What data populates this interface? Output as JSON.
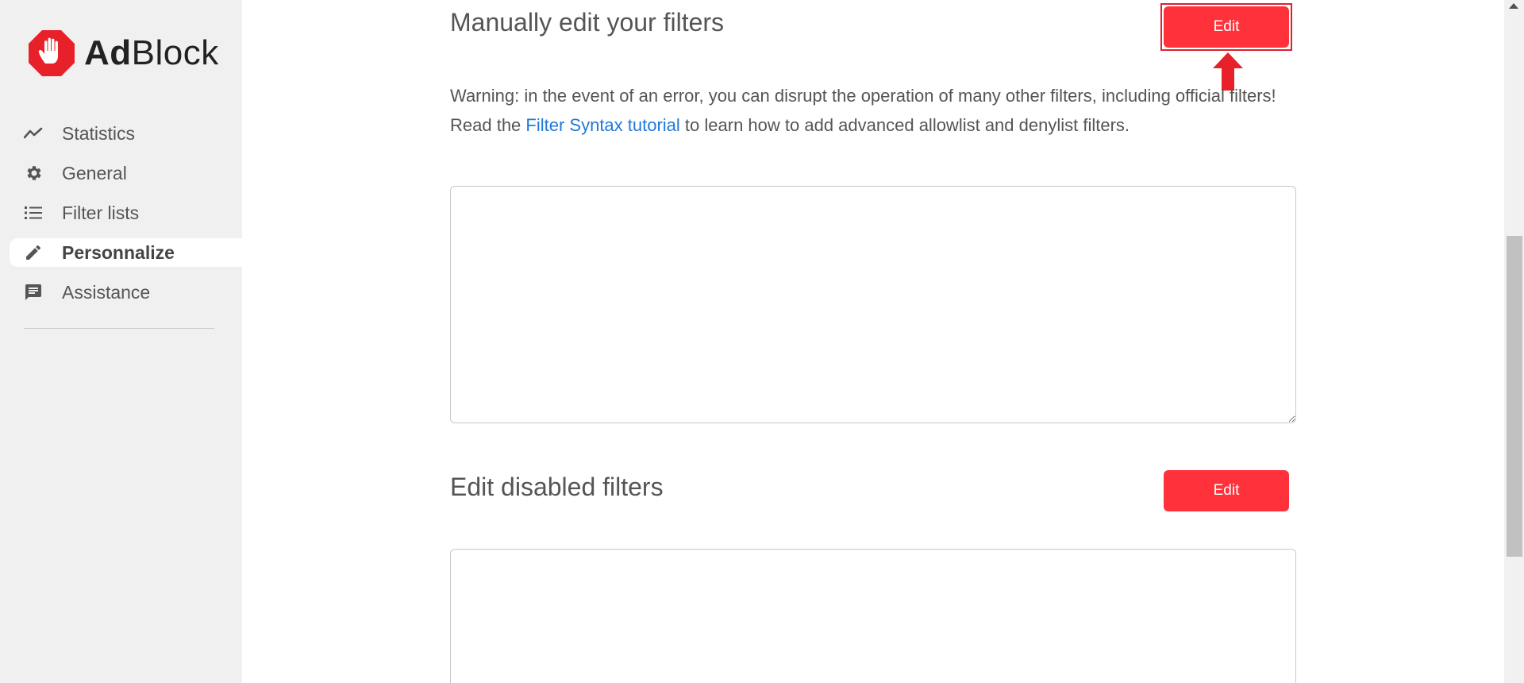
{
  "brand": {
    "name_bold": "Ad",
    "name_light": "Block",
    "badge_color": "#e8202a"
  },
  "sidebar": {
    "items": [
      {
        "label": "Statistics",
        "icon": "trend-line-icon",
        "active": false
      },
      {
        "label": "General",
        "icon": "gear-icon",
        "active": false
      },
      {
        "label": "Filter lists",
        "icon": "list-icon",
        "active": false
      },
      {
        "label": "Personnalize",
        "icon": "pencil-icon",
        "active": true
      },
      {
        "label": "Assistance",
        "icon": "chat-icon",
        "active": false
      }
    ]
  },
  "manual_section": {
    "title": "Manually edit your filters",
    "edit_label": "Edit",
    "warning_line1": "Warning: in the event of an error, you can disrupt the operation of many other filters, including official filters!",
    "read_prefix": "Read the ",
    "link_text": "Filter Syntax tutorial",
    "read_suffix": " to learn how to add advanced allowlist and denylist filters.",
    "textarea_value": ""
  },
  "disabled_section": {
    "title": "Edit disabled filters",
    "edit_label": "Edit",
    "textarea_value": ""
  },
  "colors": {
    "accent": "#ff323b",
    "link": "#2279d8",
    "sidebar_bg": "#f0f0f0",
    "highlight": "#e0202b"
  }
}
